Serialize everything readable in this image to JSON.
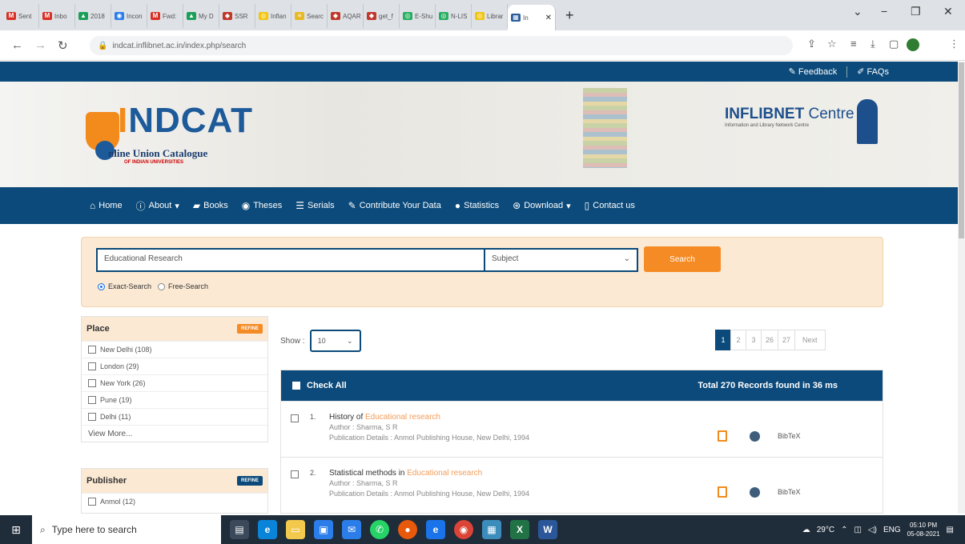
{
  "browser": {
    "tabs": [
      "Sent",
      "Inbo",
      "2018",
      "Incon",
      "Fwd:",
      "My D",
      "SSR",
      "Inflan",
      "Searc",
      "AQAR",
      "get_f",
      "E-Shu",
      "N-LIS",
      "Librar",
      "In"
    ],
    "new_tab": "+",
    "url": "indcat.inflibnet.ac.in/index.php/search",
    "window_controls": {
      "minimize": "−",
      "restore": "❐",
      "close": "✕"
    }
  },
  "topstrip": {
    "feedback": "Feedback",
    "faqs": "FAQs"
  },
  "banner": {
    "logo_text_i": "I",
    "logo_text_rest": "NDCAT",
    "logo_subtitle": "nline Union Catalogue",
    "logo_subtitle2": "OF INDIAN UNIVERSITIES",
    "partner_title_bold": "INFLIBNET",
    "partner_title_rest": " Centre",
    "partner_sub": "Information and Library Network Centre"
  },
  "nav": {
    "home": "Home",
    "about": "About",
    "books": "Books",
    "theses": "Theses",
    "serials": "Serials",
    "contribute": "Contribute Your Data",
    "statistics": "Statistics",
    "download": "Download",
    "contact": "Contact us"
  },
  "search": {
    "query": "Educational Research",
    "field": "Subject",
    "button": "Search",
    "exact": "Exact-Search",
    "free": "Free-Search",
    "exact_selected": true
  },
  "facets": {
    "place": {
      "title": "Place",
      "refine": "REFINE",
      "items": [
        "New Delhi (108)",
        "London (29)",
        "New York (26)",
        "Pune (19)",
        "Delhi (11)"
      ],
      "view_more": "View More..."
    },
    "publisher": {
      "title": "Publisher",
      "refine": "REFINE",
      "items": [
        "Anmol (12)"
      ]
    }
  },
  "results": {
    "show_label": "Show :",
    "show_value": "10",
    "pages": [
      "1",
      "2",
      "3",
      "26",
      "27",
      "Next"
    ],
    "active_page": "1",
    "check_all": "Check All",
    "total": "Total 270 Records found in 36 ms",
    "records": [
      {
        "num": "1.",
        "title_pre": "History of ",
        "title_hl": "Educational research",
        "author": "Author : Sharma, S R",
        "publication": "Publication Details : Anmol Publishing House, New Delhi, 1994",
        "bibtex": "BibTeX"
      },
      {
        "num": "2.",
        "title_pre": "Statistical methods in ",
        "title_hl": "Educational research",
        "author": "Author : Sharma, S R",
        "publication": "Publication Details : Anmol Publishing House, New Delhi, 1994",
        "bibtex": "BibTeX"
      }
    ]
  },
  "taskbar": {
    "search_placeholder": "Type here to search",
    "weather": "29°C",
    "lang": "ENG",
    "time": "05:10 PM",
    "date": "05-08-2021"
  },
  "colors": {
    "primary": "#0b4a7a",
    "accent": "#f58b25",
    "search_bg": "#fbe9d4"
  }
}
